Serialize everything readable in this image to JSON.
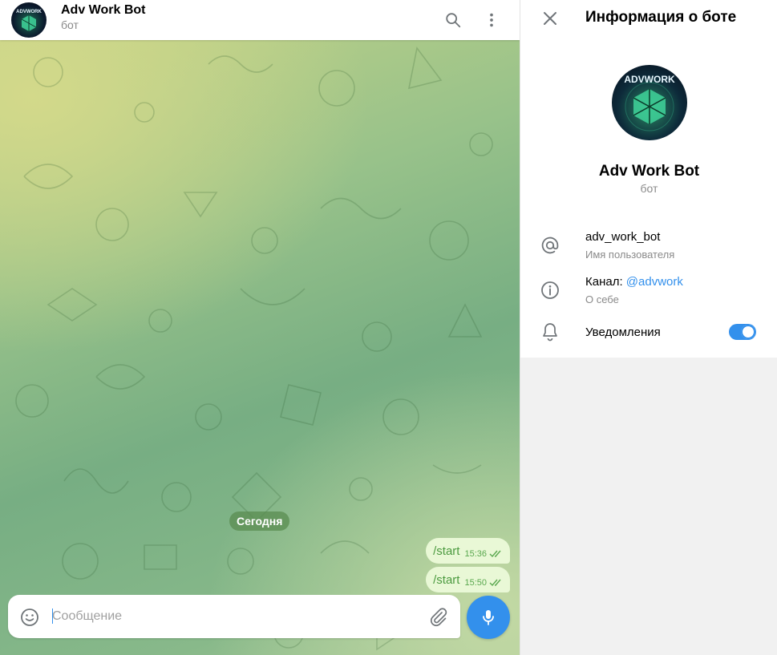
{
  "chat": {
    "title": "Adv Work Bot",
    "subtitle": "бот",
    "avatar_text": "ADVWORK",
    "date_label": "Сегодня",
    "messages": [
      {
        "text": "/start",
        "time": "15:36"
      },
      {
        "text": "/start",
        "time": "15:50"
      }
    ],
    "composer": {
      "placeholder": "Сообщение"
    }
  },
  "panel": {
    "title": "Информация о боте",
    "name": "Adv Work Bot",
    "status": "бот",
    "avatar_text": "ADVWORK",
    "username": {
      "value": "adv_work_bot",
      "label": "Имя пользователя"
    },
    "about": {
      "prefix": "Канал: ",
      "link": "@advwork",
      "label": "О себе"
    },
    "notifications": {
      "label": "Уведомления",
      "enabled": true
    }
  },
  "colors": {
    "accent": "#3390ec",
    "outgoing_bubble": "#e9f8d6",
    "outgoing_text": "#4b9a3f"
  },
  "icons": [
    "search-icon",
    "more-vertical-icon",
    "close-icon",
    "at-sign-icon",
    "info-icon",
    "bell-icon",
    "emoji-icon",
    "paperclip-icon",
    "microphone-icon",
    "read-checkmarks-icon"
  ]
}
